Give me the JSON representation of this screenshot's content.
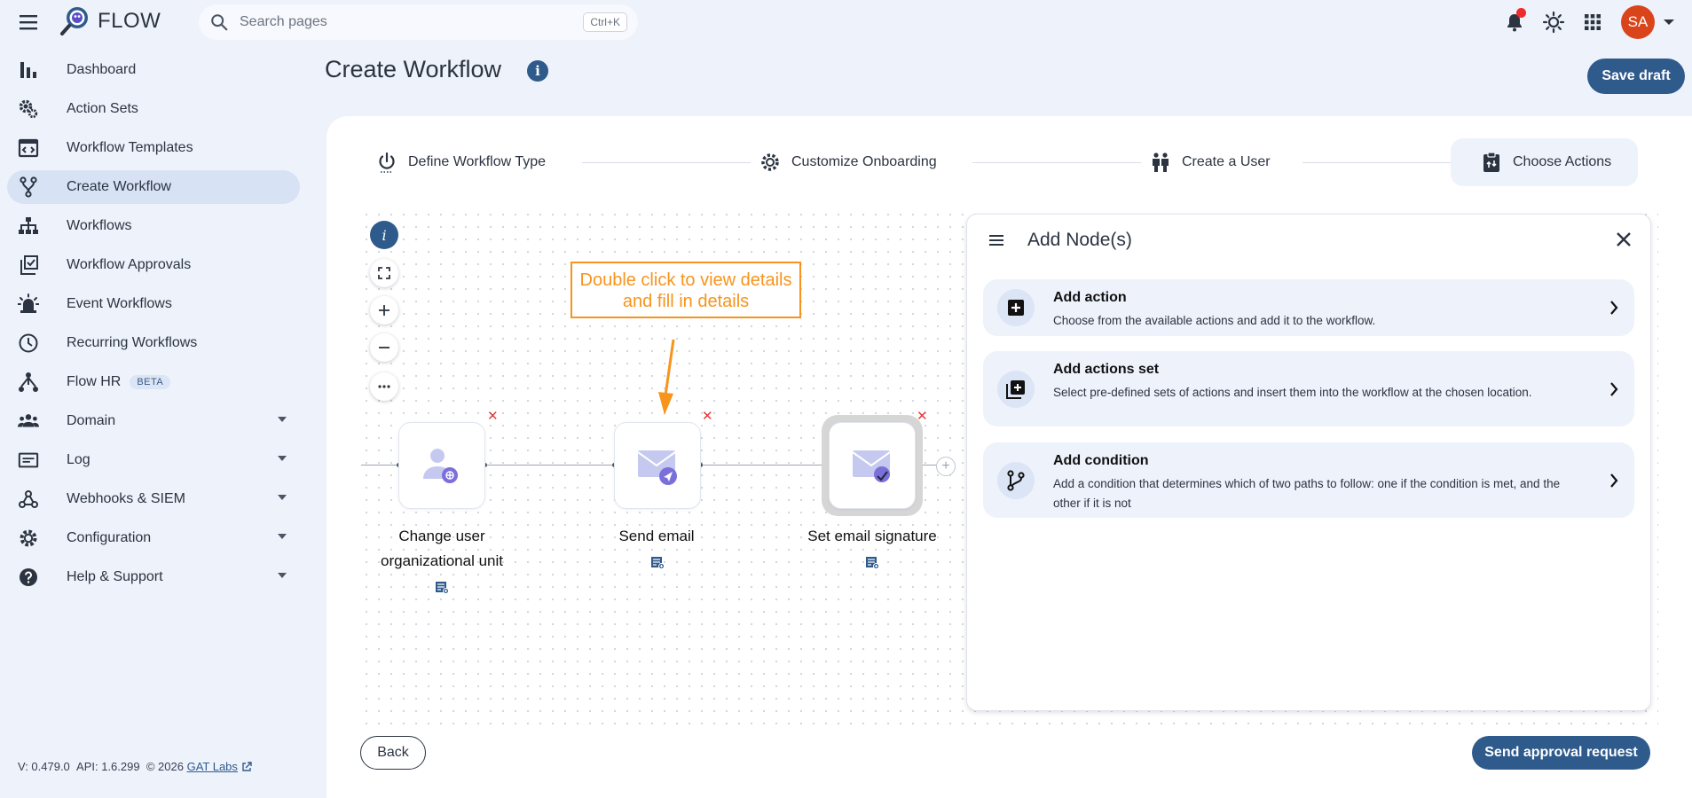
{
  "app": {
    "name": "FLOW"
  },
  "search": {
    "placeholder": "Search pages",
    "shortcut": "Ctrl+K"
  },
  "user": {
    "initials": "SA",
    "avatar_color": "#d9441a"
  },
  "sidebar": {
    "items": [
      {
        "label": "Dashboard",
        "icon": "bar-chart-icon"
      },
      {
        "label": "Action Sets",
        "icon": "gears-icon"
      },
      {
        "label": "Workflow Templates",
        "icon": "template-icon"
      },
      {
        "label": "Create Workflow",
        "icon": "fork-icon",
        "active": true
      },
      {
        "label": "Workflows",
        "icon": "hierarchy-icon"
      },
      {
        "label": "Workflow Approvals",
        "icon": "approval-check-icon"
      },
      {
        "label": "Event Workflows",
        "icon": "siren-icon"
      },
      {
        "label": "Recurring Workflows",
        "icon": "clock-icon"
      },
      {
        "label": "Flow HR",
        "icon": "hr-network-icon",
        "badge": "BETA"
      },
      {
        "label": "Domain",
        "icon": "people-icon"
      },
      {
        "label": "Log",
        "icon": "log-icon"
      },
      {
        "label": "Webhooks & SIEM",
        "icon": "webhook-icon"
      },
      {
        "label": "Configuration",
        "icon": "gear-icon"
      },
      {
        "label": "Help & Support",
        "icon": "help-icon"
      }
    ],
    "footer": {
      "version": "V: 0.479.0",
      "api": "API: 1.6.299",
      "copyright": "© 2026",
      "link": "GAT Labs"
    }
  },
  "header": {
    "title": "Create Workflow",
    "save_label": "Save draft"
  },
  "stepper": {
    "steps": [
      {
        "label": "Define Workflow Type"
      },
      {
        "label": "Customize Onboarding"
      },
      {
        "label": "Create a User"
      },
      {
        "label": "Choose Actions",
        "active": true
      }
    ]
  },
  "canvas": {
    "callout": "Double click to view details and fill in details",
    "nodes": [
      {
        "label": "Change user organizational unit"
      },
      {
        "label": "Send email"
      },
      {
        "label": "Set email signature",
        "selected": true
      }
    ]
  },
  "panel": {
    "title": "Add Node(s)",
    "options": [
      {
        "title": "Add action",
        "desc": "Choose from the available actions and add it to the workflow."
      },
      {
        "title": "Add actions set",
        "desc": "Select pre-defined sets of actions and insert them into the workflow at the chosen location."
      },
      {
        "title": "Add condition",
        "desc": "Add a condition that determines which of two paths to follow: one if the condition is met, and the other if it is not"
      }
    ]
  },
  "footer_actions": {
    "back": "Back",
    "send": "Send approval request"
  },
  "colors": {
    "primary": "#2f5a8c",
    "callout": "#f7941d",
    "danger": "#e53935",
    "background": "#eef2fb"
  }
}
